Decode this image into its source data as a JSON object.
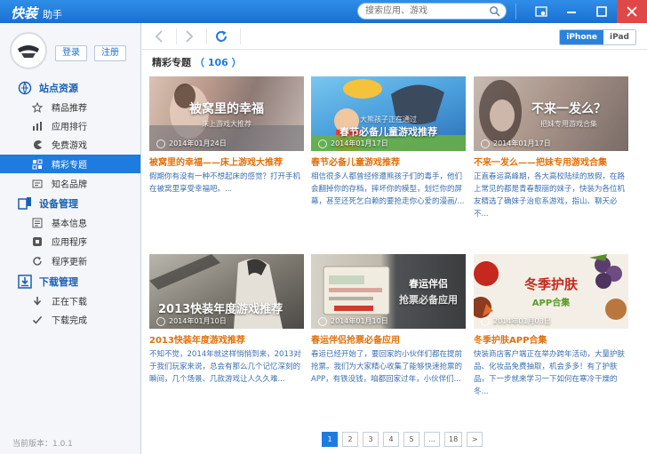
{
  "app": {
    "logo": "快装",
    "subtitle": "助手"
  },
  "search": {
    "placeholder": "搜索应用、游戏"
  },
  "account": {
    "login": "登录",
    "register": "注册"
  },
  "sidebar": {
    "sections": [
      {
        "label": "站点资源",
        "icon": "site-icon"
      },
      {
        "label": "设备管理",
        "icon": "device-icon"
      },
      {
        "label": "下载管理",
        "icon": "download-icon"
      }
    ],
    "items": [
      {
        "label": "精品推荐",
        "icon": "star-icon"
      },
      {
        "label": "应用排行",
        "icon": "bar-chart-icon"
      },
      {
        "label": "免费游戏",
        "icon": "pacman-icon"
      },
      {
        "label": "精彩专题",
        "icon": "grid-icon",
        "active": true
      },
      {
        "label": "知名品牌",
        "icon": "brand-icon"
      },
      {
        "label": "基本信息",
        "icon": "info-icon"
      },
      {
        "label": "应用程序",
        "icon": "app-icon"
      },
      {
        "label": "程序更新",
        "icon": "refresh-icon"
      },
      {
        "label": "正在下载",
        "icon": "arrow-down-icon"
      },
      {
        "label": "下载完成",
        "icon": "check-icon"
      }
    ],
    "version": "当前版本：1.0.1"
  },
  "toolbar": {
    "iphone": "iPhone",
    "ipad": "iPad"
  },
  "content": {
    "heading": "精彩专题",
    "count": "（ 106 ）",
    "cards": [
      {
        "overlay_title": "被窝里的幸福",
        "overlay_sub": "床上游戏大推荐",
        "date": "2014年01月24日",
        "title": "被窝里的幸福——床上游戏大推荐",
        "desc": "假期你有没有一种不想起床的感觉？打开手机在被窝里享受幸福吧。..."
      },
      {
        "overlay_title": "春节必备儿童游戏推荐",
        "overlay_sub": "大熊孩子正在通过",
        "date": "2014年01月17日",
        "title": "春节必备儿童游戏推荐",
        "desc": "相信很多人都曾经修遭熊孩子们的毒手，他们会翻掉你的存档，摔坏你的模型，划烂你的屏幕，甚至还死乞白赖的要抢走你心爱的漫画/..."
      },
      {
        "overlay_title": "不来一发么？",
        "overlay_sub": "把妹专用游戏合集",
        "date": "2014年01月17日",
        "title": "不来一发么——把妹专用游戏合集",
        "desc": "正直春运高峰期，各大高校陆续的放假，在路上常见的都是青春靓丽的妹子，快装为各位机友精选了确妹子治愈系游戏，指山、聊天必不..."
      },
      {
        "overlay_title": "2013快装年度游戏推荐",
        "overlay_sub": "",
        "date": "2014年01月10日",
        "title": "2013快装年度游戏推荐",
        "desc": "不知不觉，2014年就这样悄悄到来，2013对于我们玩家来说，总会有那么几个记忆深刻的瞬间，几个场景、几款游戏让人久久难..."
      },
      {
        "overlay_title": "春运伴侣",
        "overlay_sub": "抢票必备应用",
        "date": "2014年01月10日",
        "title": "春运伴侣抢票必备应用",
        "desc": "春运已经开始了，要回家的小伙伴们都在提前抢票。我们为大家精心收集了能够快速抢票的APP，有铁没钱，咱都回家过年，小伙伴们..."
      },
      {
        "overlay_title": "冬季护肤",
        "overlay_sub": "APP合集",
        "date": "2014年01月03日",
        "title": "冬季护肤APP合集",
        "desc": "快装商店客户端正在举办跨年活动，大量护肤品、化妆品免费抽取，机会多多！有了护肤品，下一步就来学习一下如何在寒冷干燥的冬..."
      }
    ]
  },
  "pagination": {
    "pages": [
      "1",
      "2",
      "3",
      "4",
      "5",
      "...",
      "18",
      ">"
    ],
    "current": "1"
  },
  "colors": {
    "accent": "#1e7be0",
    "title_orange": "#e0700b",
    "desc_blue": "#3a6fb0"
  }
}
